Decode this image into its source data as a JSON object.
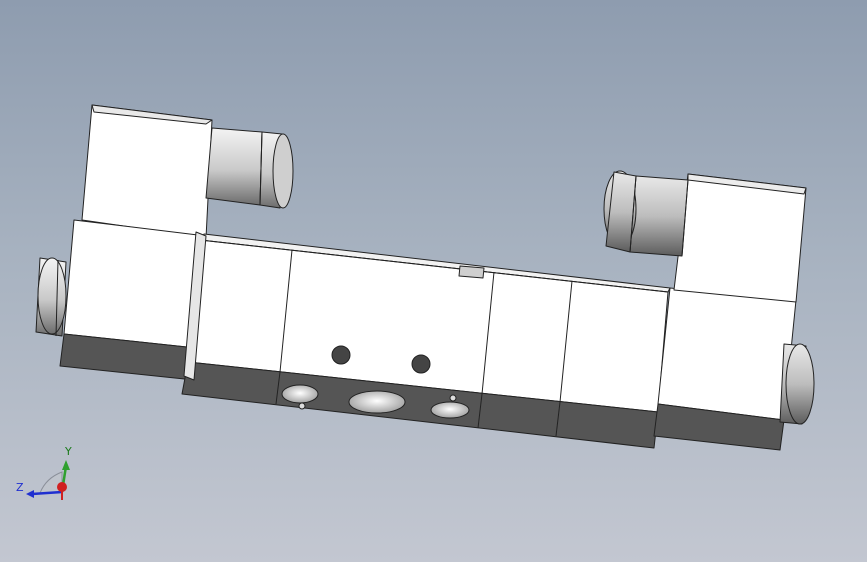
{
  "viewport": {
    "background_top": "#8e9caf",
    "background_bottom": "#c3c7d1"
  },
  "model": {
    "face_color": "#ffffff",
    "shadow_color": "#555555",
    "edge_color": "#222222"
  },
  "triad": {
    "y_label": "Y",
    "z_label": "Z",
    "y_color": "#2fa02f",
    "z_color": "#1f2fd0",
    "x_color": "#d02020"
  }
}
